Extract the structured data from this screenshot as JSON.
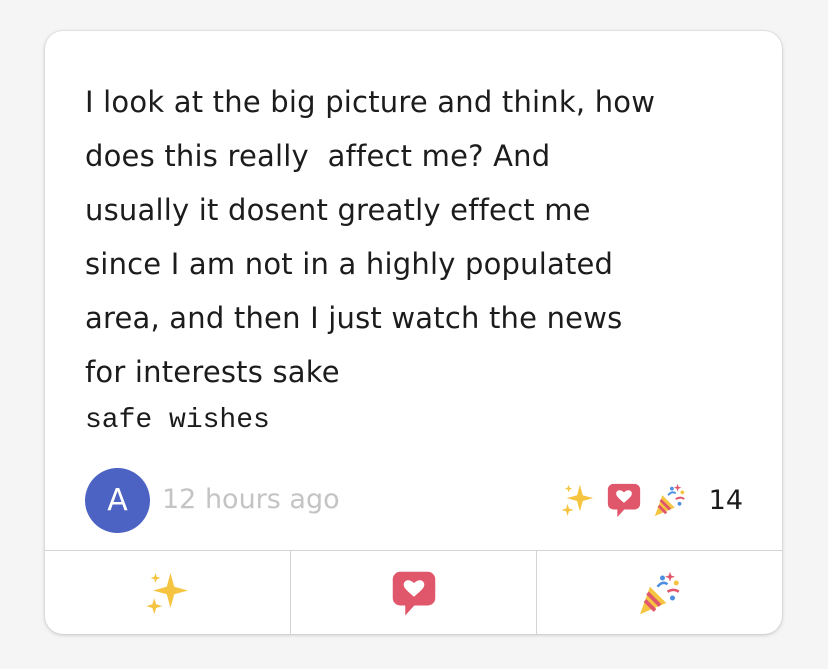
{
  "post": {
    "body": "I look at the big picture and think, how\ndoes this really  affect me? And\nusually it dosent greatly effect me\nsince I am not in a highly populated\narea, and then I just watch the news\nfor interests sake",
    "signature": "safe wishes"
  },
  "author": {
    "avatar_initial": "A",
    "avatar_color": "#4c63c4",
    "timestamp": "12 hours ago"
  },
  "reactions": {
    "summary_icons": [
      "sparkles-icon",
      "heart-speech-bubble-icon",
      "party-popper-icon"
    ],
    "count": "14"
  },
  "actions": [
    {
      "icon": "sparkles-icon"
    },
    {
      "icon": "heart-speech-bubble-icon"
    },
    {
      "icon": "party-popper-icon"
    }
  ],
  "colors": {
    "sparkle": "#f5c542",
    "heart_bubble": "#e0566a",
    "timestamp": "#c4c4c4"
  }
}
